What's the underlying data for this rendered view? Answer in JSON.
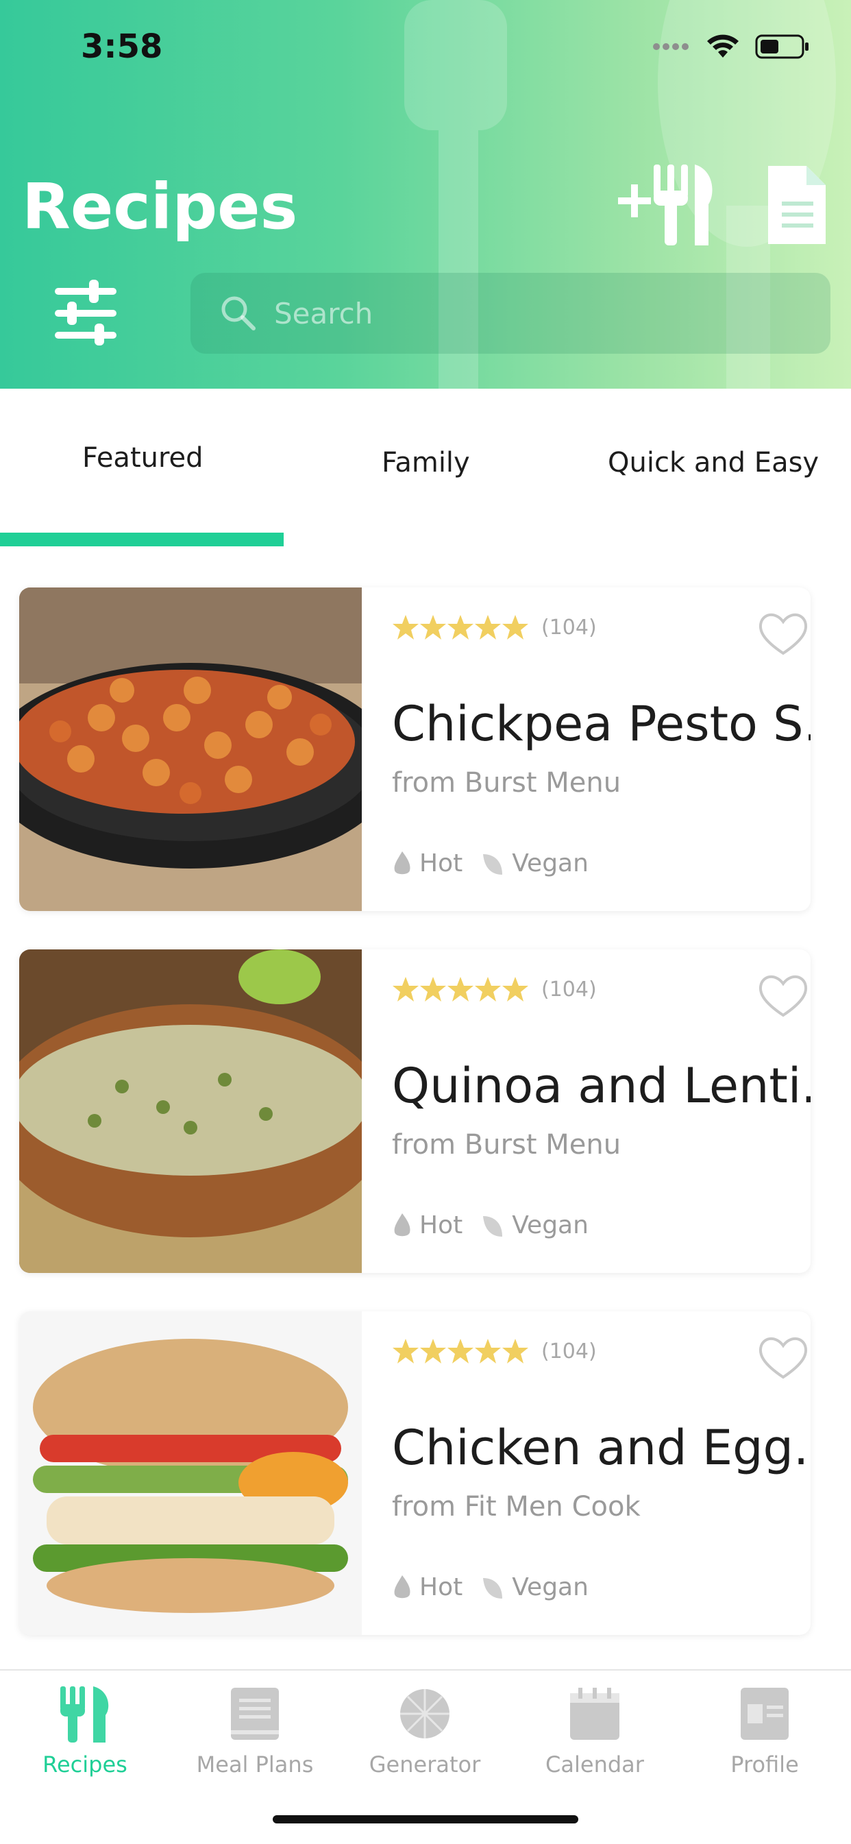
{
  "status": {
    "time": "3:58"
  },
  "header": {
    "title": "Recipes",
    "search_placeholder": "Search",
    "add_icon": "add-utensils-icon",
    "doc_icon": "document-icon",
    "filter_icon": "filter-sliders-icon"
  },
  "tabs": [
    {
      "label": "Featured",
      "active": true
    },
    {
      "label": "Family",
      "active": false
    },
    {
      "label": "Quick and Easy",
      "active": false
    }
  ],
  "recipes": [
    {
      "title": "Chickpea Pesto S...",
      "source": "from Burst Menu",
      "rating_count": "(104)",
      "stars": 5,
      "tags": [
        "Hot",
        "Vegan"
      ]
    },
    {
      "title": "Quinoa and Lenti...",
      "source": "from Burst Menu",
      "rating_count": "(104)",
      "stars": 5,
      "tags": [
        "Hot",
        "Vegan"
      ]
    },
    {
      "title": "Chicken and Egg...",
      "source": "from Fit Men Cook",
      "rating_count": "(104)",
      "stars": 5,
      "tags": [
        "Hot",
        "Vegan"
      ]
    }
  ],
  "bottom_nav": [
    {
      "label": "Recipes",
      "icon": "utensils-icon",
      "active": true
    },
    {
      "label": "Meal Plans",
      "icon": "book-icon",
      "active": false
    },
    {
      "label": "Generator",
      "icon": "wheel-icon",
      "active": false
    },
    {
      "label": "Calendar",
      "icon": "calendar-icon",
      "active": false
    },
    {
      "label": "Profile",
      "icon": "profile-card-icon",
      "active": false
    }
  ],
  "colors": {
    "accent": "#1fcf96",
    "star": "#f1cf60",
    "header_start": "#36c99a",
    "header_end": "#c9f1b8"
  }
}
